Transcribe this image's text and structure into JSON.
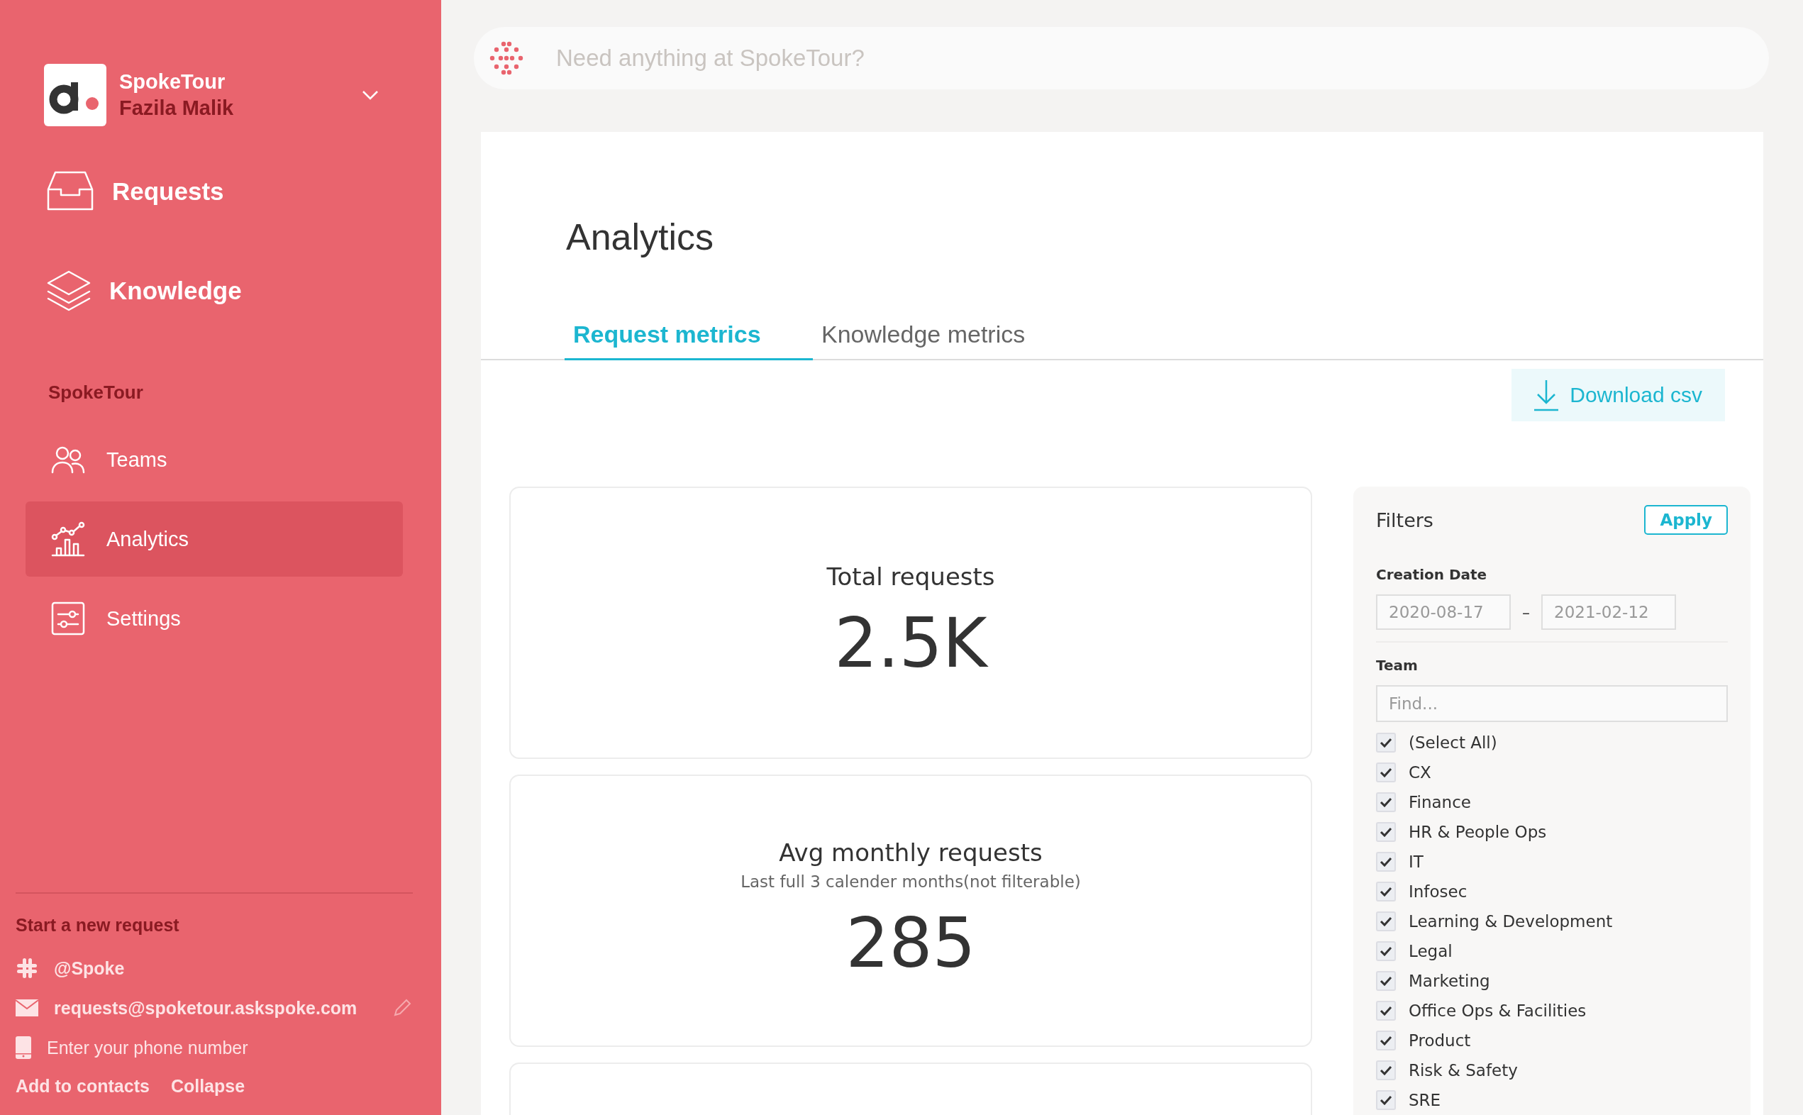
{
  "workspace": {
    "name": "SpokeTour",
    "user": "Fazila Malik"
  },
  "primary_nav": [
    {
      "label": "Requests",
      "selected": false
    },
    {
      "label": "Knowledge",
      "selected": false
    }
  ],
  "section": {
    "title": "SpokeTour",
    "items": [
      {
        "label": "Teams",
        "selected": false
      },
      {
        "label": "Analytics",
        "selected": true
      },
      {
        "label": "Settings",
        "selected": false
      }
    ]
  },
  "contact": {
    "title": "Start a new request",
    "slack": "@Spoke",
    "email": "requests@spoketour.askspoke.com",
    "phone_placeholder": "Enter your phone number",
    "links": [
      "Add to contacts",
      "Collapse"
    ]
  },
  "search": {
    "placeholder": "Need anything at SpokeTour?"
  },
  "page": {
    "title": "Analytics",
    "tabs": [
      {
        "label": "Request metrics",
        "selected": true
      },
      {
        "label": "Knowledge metrics",
        "selected": false
      }
    ],
    "download": "Download csv",
    "cards": [
      {
        "title": "Total requests",
        "value": "2.5K"
      },
      {
        "title": "Avg monthly requests",
        "subtitle": "Last full 3 calender months(not filterable)",
        "value": "285"
      }
    ],
    "filters": {
      "title": "Filters",
      "apply": "Apply",
      "date_label": "Creation Date",
      "date_from": "2020-08-17",
      "date_sep": "–",
      "date_to": "2021-02-12",
      "team_label": "Team",
      "find_placeholder": "Find...",
      "teams": [
        {
          "label": "(Select All)",
          "checked": true
        },
        {
          "label": "CX",
          "checked": true
        },
        {
          "label": "Finance",
          "checked": true
        },
        {
          "label": "HR & People Ops",
          "checked": true
        },
        {
          "label": "IT",
          "checked": true
        },
        {
          "label": "Infosec",
          "checked": true
        },
        {
          "label": "Learning & Development",
          "checked": true
        },
        {
          "label": "Legal",
          "checked": true
        },
        {
          "label": "Marketing",
          "checked": true
        },
        {
          "label": "Office Ops & Facilities",
          "checked": true
        },
        {
          "label": "Product",
          "checked": true
        },
        {
          "label": "Risk & Safety",
          "checked": true
        },
        {
          "label": "SRE",
          "checked": true
        }
      ]
    }
  }
}
